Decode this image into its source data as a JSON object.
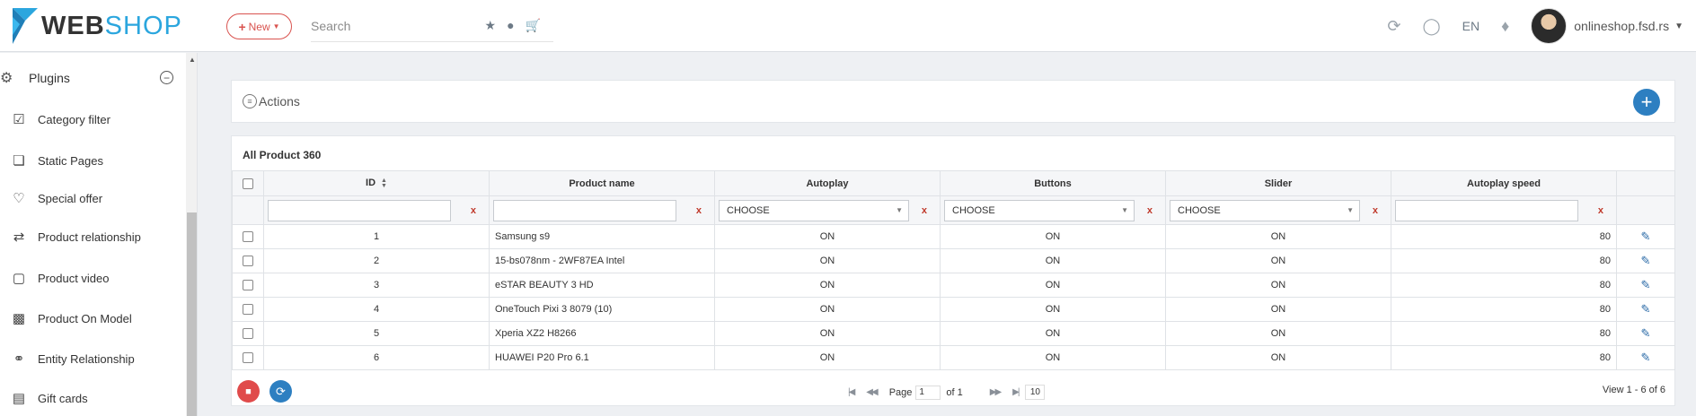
{
  "header": {
    "logo_web": "WEB",
    "logo_shop": "SHOP",
    "new_label": "New",
    "search_placeholder": "Search",
    "language": "EN",
    "user_name": "onlineshop.fsd.rs"
  },
  "sidebar": {
    "section_label": "Plugins",
    "items": [
      {
        "label": "Category filter",
        "icon": "checkbox-edit-icon"
      },
      {
        "label": "Static Pages",
        "icon": "bookmark-icon"
      },
      {
        "label": "Special offer",
        "icon": "heart-icon"
      },
      {
        "label": "Product relationship",
        "icon": "shuffle-icon"
      },
      {
        "label": "Product video",
        "icon": "video-icon"
      },
      {
        "label": "Product On Model",
        "icon": "image-icon"
      },
      {
        "label": "Entity Relationship",
        "icon": "link-icon"
      },
      {
        "label": "Gift cards",
        "icon": "gift-icon"
      }
    ]
  },
  "actions": {
    "label": "Actions"
  },
  "table": {
    "title": "All Product 360",
    "columns": [
      "ID",
      "Product name",
      "Autoplay",
      "Buttons",
      "Slider",
      "Autoplay speed"
    ],
    "filter_choose": "CHOOSE",
    "filter_clear": "x",
    "rows": [
      {
        "id": "1",
        "name": "Samsung s9",
        "autoplay": "ON",
        "buttons": "ON",
        "slider": "ON",
        "speed": "80"
      },
      {
        "id": "2",
        "name": "15-bs078nm - 2WF87EA Intel",
        "autoplay": "ON",
        "buttons": "ON",
        "slider": "ON",
        "speed": "80"
      },
      {
        "id": "3",
        "name": "eSTAR BEAUTY 3 HD",
        "autoplay": "ON",
        "buttons": "ON",
        "slider": "ON",
        "speed": "80"
      },
      {
        "id": "4",
        "name": "OneTouch Pixi 3 8079 (10)",
        "autoplay": "ON",
        "buttons": "ON",
        "slider": "ON",
        "speed": "80"
      },
      {
        "id": "5",
        "name": "Xperia XZ2 H8266",
        "autoplay": "ON",
        "buttons": "ON",
        "slider": "ON",
        "speed": "80"
      },
      {
        "id": "6",
        "name": "HUAWEI P20 Pro 6.1",
        "autoplay": "ON",
        "buttons": "ON",
        "slider": "ON",
        "speed": "80"
      }
    ]
  },
  "pager": {
    "page_label": "Page",
    "page_value": "1",
    "of_label": "of 1",
    "page_size": "10",
    "view_info": "View 1 - 6 of 6"
  },
  "colors": {
    "accent_blue": "#2d7fc1",
    "danger_red": "#d9534f",
    "logo_blue": "#2ba6de"
  }
}
